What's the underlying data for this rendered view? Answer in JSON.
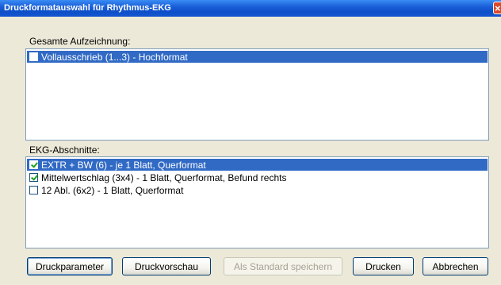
{
  "window": {
    "title": "Druckformatauswahl für Rhythmus-EKG",
    "close_glyph": "×"
  },
  "gesamte": {
    "label": "Gesamte Aufzeichnung:",
    "items": [
      {
        "label": "Vollausschrieb (1...3) - Hochformat",
        "checked": false,
        "selected": true
      }
    ]
  },
  "abschnitte": {
    "label": "EKG-Abschnitte:",
    "items": [
      {
        "label": "EXTR + BW (6) - je 1 Blatt, Querformat",
        "checked": true,
        "selected": true
      },
      {
        "label": "Mittelwertschlag (3x4) - 1 Blatt, Querformat, Befund rechts",
        "checked": true,
        "selected": false
      },
      {
        "label": "12 Abl. (6x2) - 1 Blatt, Querformat",
        "checked": false,
        "selected": false
      }
    ]
  },
  "buttons": {
    "druckparameter": "Druckparameter",
    "druckvorschau": "Druckvorschau",
    "als_standard": "Als Standard speichern",
    "drucken": "Drucken",
    "abbrechen": "Abbrechen"
  },
  "colors": {
    "selection": "#316ac5",
    "titlebar": "#0d4fc8",
    "dialog_bg": "#ece9d8"
  }
}
